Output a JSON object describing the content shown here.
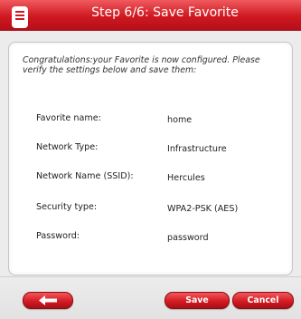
{
  "window": {
    "title": "Step 6/6: Save Favorite"
  },
  "panel": {
    "intro": "Congratulations:your Favorite is now configured. Please verify the settings below and save them:",
    "fields": [
      {
        "label": "Favorite name:",
        "value": "home"
      },
      {
        "label": "Network Type:",
        "value": "Infrastructure"
      },
      {
        "label": "Network Name (SSID):",
        "value": "Hercules"
      },
      {
        "label": "Security type:",
        "value": "WPA2-PSK (AES)"
      },
      {
        "label": "Password:",
        "value": "password"
      }
    ]
  },
  "footer": {
    "back_icon": "arrow-left-icon",
    "save_label": "Save",
    "cancel_label": "Cancel"
  },
  "colors": {
    "accent": "#d01820",
    "panel_bg": "#ffffff",
    "window_bg": "#ececec"
  }
}
